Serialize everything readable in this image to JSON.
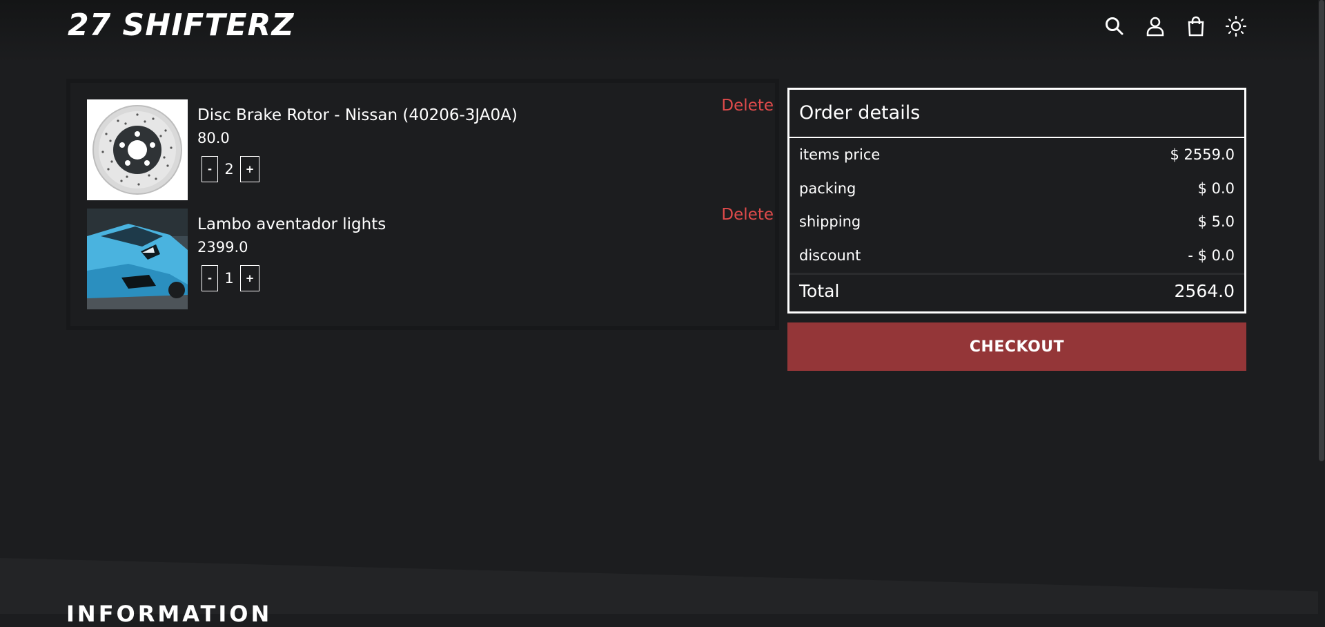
{
  "header": {
    "logo_text": "27 SHIFTERZ",
    "icons": [
      "search-icon",
      "user-icon",
      "shopping-bag-icon",
      "sun-icon"
    ]
  },
  "cart": {
    "items": [
      {
        "name": "Disc Brake Rotor - Nissan (40206-3JA0A)",
        "price": "80.0",
        "quantity": "2",
        "minus_label": "-",
        "plus_label": "+",
        "delete_label": "Delete",
        "image": "disc-brake-rotor-image"
      },
      {
        "name": "Lambo aventador lights",
        "price": "2399.0",
        "quantity": "1",
        "minus_label": "-",
        "plus_label": "+",
        "delete_label": "Delete",
        "image": "blue-lamborghini-image"
      }
    ]
  },
  "order": {
    "title": "Order details",
    "rows": [
      {
        "label": "items price",
        "value": "$ 2559.0"
      },
      {
        "label": "packing",
        "value": "$ 0.0"
      },
      {
        "label": "shipping",
        "value": "$ 5.0"
      },
      {
        "label": "discount",
        "value": "- $ 0.0"
      }
    ],
    "total_label": "Total",
    "total_value": "2564.0",
    "checkout_label": "CHECKOUT"
  },
  "footer": {
    "title": "INFORMATION"
  },
  "colors": {
    "background": "#1c1d1f",
    "delete": "#e04b4b",
    "checkout": "#943638"
  }
}
